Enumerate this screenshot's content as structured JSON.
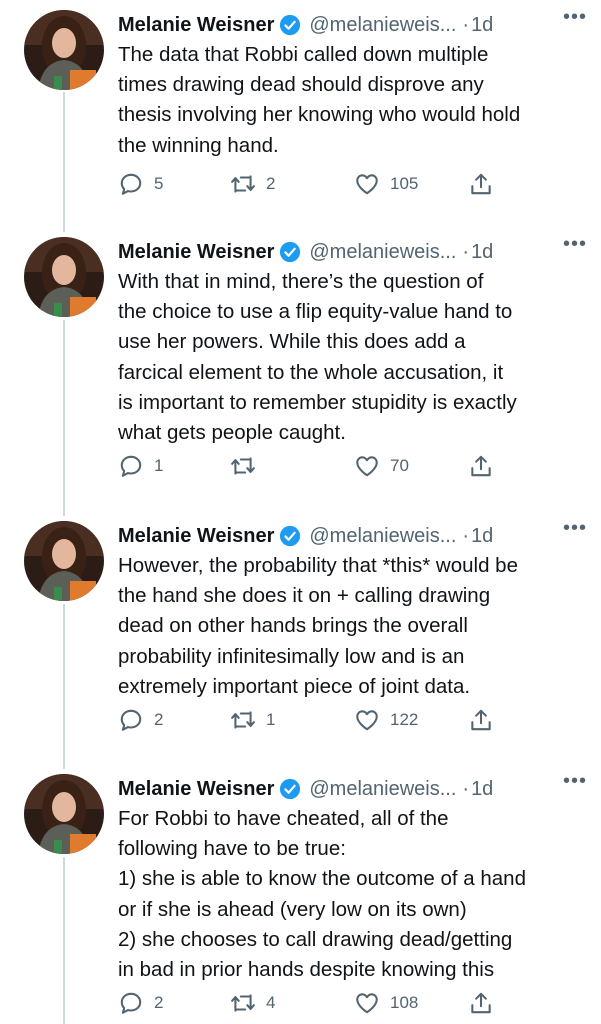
{
  "tweets": [
    {
      "author": "Melanie Weisner",
      "handle": "@melanieweis...",
      "separator": "·",
      "time": "1d",
      "more": "•••",
      "text": "The data that Robbi called down multiple\ntimes drawing dead should disprove any\nthesis involving her knowing who would hold\nthe winning hand.",
      "replies": "5",
      "retweets": "2",
      "likes": "105"
    },
    {
      "author": "Melanie Weisner",
      "handle": "@melanieweis...",
      "separator": "·",
      "time": "1d",
      "more": "•••",
      "text": "With that in mind, there’s the question of\nthe choice to use a flip equity-value hand to\nuse her powers. While this does add a\nfarcical element to the whole accusation, it\nis important to remember stupidity is exactly\nwhat gets people caught.",
      "replies": "1",
      "retweets": "",
      "likes": "70"
    },
    {
      "author": "Melanie Weisner",
      "handle": "@melanieweis...",
      "separator": "·",
      "time": "1d",
      "more": "•••",
      "text": "However, the probability that *this* would be\nthe hand she does it on + calling drawing\ndead on other hands brings the overall\nprobability infinitesimally low and is an\nextremely important piece of joint data.",
      "replies": "2",
      "retweets": "1",
      "likes": "122"
    },
    {
      "author": "Melanie Weisner",
      "handle": "@melanieweis...",
      "separator": "·",
      "time": "1d",
      "more": "•••",
      "text": "For Robbi to have cheated, all of the\nfollowing have to be true:\n1) she is able to know the outcome of a hand\nor if she is ahead (very low on its own)\n2) she chooses to call drawing dead/getting\nin bad in prior hands despite knowing this",
      "replies": "2",
      "retweets": "4",
      "likes": "108"
    }
  ],
  "icons": {
    "avatar": "avatar-photo",
    "verified": "verified-badge-icon",
    "reply": "reply-icon",
    "retweet": "retweet-icon",
    "like": "heart-icon",
    "share": "share-icon",
    "more": "more-options-icon"
  },
  "colors": {
    "text": "#0f1419",
    "secondary": "#536471",
    "verified": "#1d9bf0",
    "thread_line": "#cfd9de"
  }
}
